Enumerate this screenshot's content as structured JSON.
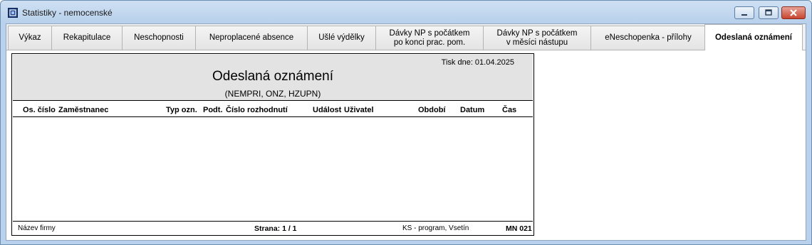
{
  "window": {
    "title": "Statistiky - nemocenské",
    "icon": "app-logo-icon",
    "controls": [
      "minimize-icon",
      "maximize-icon",
      "close-icon"
    ]
  },
  "tabs": [
    {
      "label": "Výkaz"
    },
    {
      "label": "Rekapitulace"
    },
    {
      "label": "Neschopnosti"
    },
    {
      "label": "Neproplacené absence"
    },
    {
      "label": "Ušlé výdělky"
    },
    {
      "label": "Dávky NP s počátkem\npo konci prac. pom."
    },
    {
      "label": "Dávky NP s počátkem\nv měsíci nástupu"
    },
    {
      "label": "eNeschopenka - přílohy"
    },
    {
      "label": "Odeslaná oznámení",
      "active": true
    }
  ],
  "report": {
    "print_date": "Tisk dne: 01.04.2025",
    "title": "Odeslaná oznámení",
    "subtitle": "(NEMPRI, ONZ, HZUPN)",
    "columns": [
      "Os. číslo",
      "Zaměstnanec",
      "Typ ozn.",
      "Podt.",
      "Číslo rozhodnutí",
      "Událost",
      "Uživatel",
      "Období",
      "Datum",
      "Čas"
    ],
    "rows": [],
    "footer": {
      "company": "Název firmy",
      "page": "Strana: 1 / 1",
      "vendor": "KS - program, Vsetín",
      "code": "MN 021"
    }
  }
}
